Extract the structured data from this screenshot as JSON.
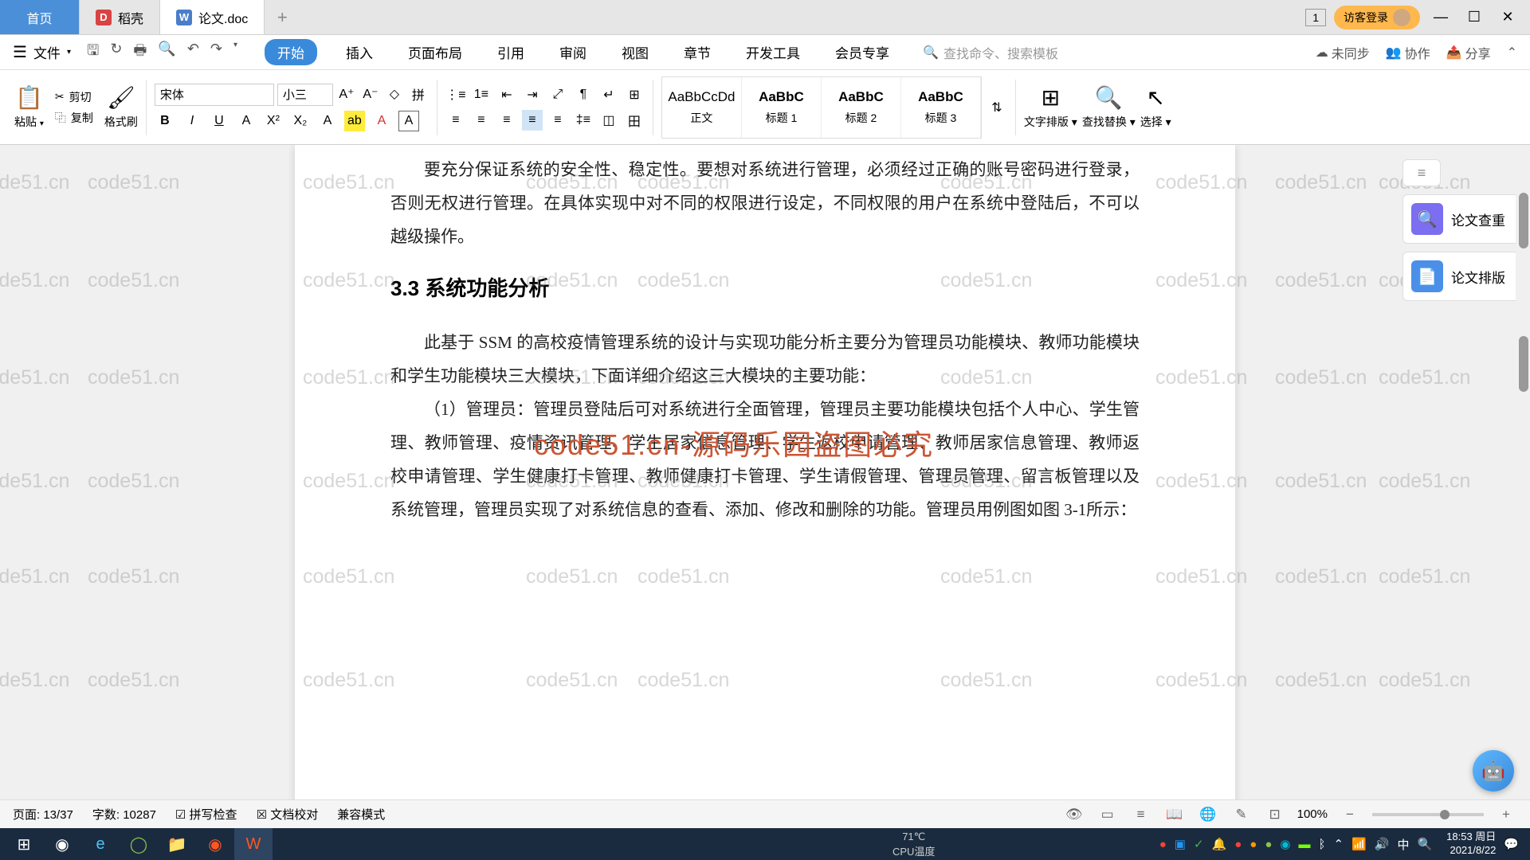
{
  "tabs": {
    "home": "首页",
    "daoke": "稻壳",
    "doc": "论文.doc"
  },
  "titleRight": {
    "counter": "1",
    "login": "访客登录"
  },
  "menu": {
    "file": "文件",
    "tabs": [
      "开始",
      "插入",
      "页面布局",
      "引用",
      "审阅",
      "视图",
      "章节",
      "开发工具",
      "会员专享"
    ],
    "searchPlaceholder": "查找命令、搜索模板",
    "unsync": "未同步",
    "coop": "协作",
    "share": "分享"
  },
  "ribbon": {
    "paste": "粘贴",
    "cut": "剪切",
    "copy": "复制",
    "formatPainter": "格式刷",
    "fontName": "宋体",
    "fontSize": "小三",
    "styles": [
      {
        "preview": "AaBbCcDd",
        "label": "正文"
      },
      {
        "preview": "AaBbC",
        "label": "标题 1"
      },
      {
        "preview": "AaBbC",
        "label": "标题 2"
      },
      {
        "preview": "AaBbC",
        "label": "标题 3"
      }
    ],
    "textLayout": "文字排版",
    "findReplace": "查找替换",
    "select": "选择"
  },
  "document": {
    "p1": "要充分保证系统的安全性、稳定性。要想对系统进行管理，必须经过正确的账号密码进行登录，否则无权进行管理。在具体实现中对不同的权限进行设定，不同权限的用户在系统中登陆后，不可以越级操作。",
    "h1": "3.3 系统功能分析",
    "p2": "此基于 SSM 的高校疫情管理系统的设计与实现功能分析主要分为管理员功能模块、教师功能模块和学生功能模块三大模块，下面详细介绍这三大模块的主要功能：",
    "p3": "（1）管理员：管理员登陆后可对系统进行全面管理，管理员主要功能模块包括个人中心、学生管理、教师管理、疫情资讯管理、学生居家信息管理、学生返校申请管理、教师居家信息管理、教师返校申请管理、学生健康打卡管理、教师健康打卡管理、学生请假管理、管理员管理、留言板管理以及系统管理，管理员实现了对系统信息的查看、添加、修改和删除的功能。管理员用例图如图 3-1所示："
  },
  "sidePanel": {
    "check": "论文查重",
    "layout": "论文排版"
  },
  "watermark": {
    "text": "code51.cn",
    "red": "code51.cn-源码乐园盗图必究"
  },
  "status": {
    "page": "页面: 13/37",
    "words": "字数: 10287",
    "spellcheck": "拼写检查",
    "docCheck": "文档校对",
    "compat": "兼容模式",
    "zoom": "100%"
  },
  "taskbar": {
    "cpuLabel": "CPU温度",
    "cpuTemp": "71℃",
    "time": "18:53 周日",
    "date": "2021/8/22"
  }
}
